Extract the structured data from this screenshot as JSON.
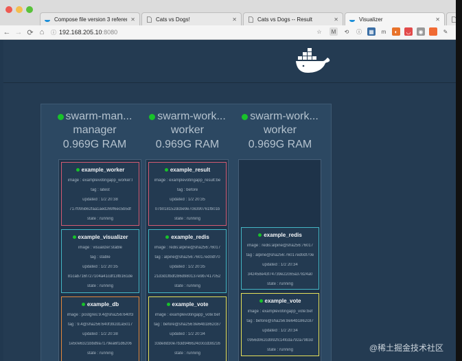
{
  "browser": {
    "tabs": [
      {
        "label": "Compose file version 3 referen",
        "icon": "docker-icon"
      },
      {
        "label": "Cats vs Dogs!",
        "icon": "page-icon"
      },
      {
        "label": "Cats vs Dogs -- Result",
        "icon": "page-icon"
      },
      {
        "label": "Visualizer",
        "icon": "docker-icon",
        "active": true
      }
    ],
    "url": {
      "host": "192.168.205.10",
      "port": ":8080"
    }
  },
  "swarm": {
    "nodes": [
      {
        "name": "swarm-man...",
        "role": "manager",
        "ram": "0.969G RAM",
        "containers": [
          {
            "name": "example_worker",
            "image": "image : examplevotingapp_worker:l",
            "tag": "tag : latest",
            "updated": "updated : 1/2 20:38",
            "id": "717f095b62faa1aed269f6ec5b5df",
            "state": "state : running",
            "color": "red"
          },
          {
            "name": "example_visualizer",
            "image": "image : visualizer:stable",
            "tag": "tag : stable",
            "updated": "updated : 1/2 20:35",
            "id": "81cab716f727104a41cdf13fb161de",
            "state": "state : running",
            "color": "teal"
          },
          {
            "name": "example_db",
            "image": "image : postgres:9.4@sha256:640f3",
            "tag": "tag : 9.4@sha256:640f392d1a5017",
            "updated": "updated : 1/2 20:38",
            "id": "1e50e6321bbd9a7179ea6f1d6206",
            "state": "state : running",
            "color": "orange"
          }
        ]
      },
      {
        "name": "swarm-work...",
        "role": "worker",
        "ram": "0.969G RAM",
        "containers": [
          {
            "name": "example_result",
            "image": "image : examplevotingapp_result:be",
            "tag": "tag : before",
            "updated": "updated : 1/2 20:35",
            "id": "07b018152dcbe9e7c6390761fb01b",
            "state": "state : running",
            "color": "red"
          },
          {
            "name": "example_redis",
            "image": "image : redis:alpine@sha256:76017",
            "tag": "tag : alpine@sha256:76017ed0df70",
            "updated": "updated : 1/2 20:35",
            "id": "21d3d1fbdf286d980137e9b7417052",
            "state": "state : running",
            "color": "teal"
          },
          {
            "name": "example_vote",
            "image": "image : examplevotingapp_vote:bef",
            "tag": "tag : before@sha256:8e64b1862c87",
            "updated": "updated : 1/2 20:34",
            "id": "33de8d30e7b3d946624c0ccd38216",
            "state": "state : running",
            "color": "yellow"
          }
        ]
      },
      {
        "name": "swarm-work...",
        "role": "worker",
        "ram": "0.969G RAM",
        "containers": [
          {
            "name": "example_redis",
            "image": "image : redis:alpine@sha256:76017",
            "tag": "tag : alpine@sha256:76017ed0df70e",
            "updated": "updated : 1/2 20:34",
            "id": "342458e43f74739e22c65a37824a0",
            "state": "state : running",
            "color": "teal"
          },
          {
            "name": "example_vote",
            "image": "image : examplevotingapp_vote:bef",
            "tag": "tag : before@sha256:8e64b1862c87",
            "updated": "updated : 1/2 20:34",
            "id": "0956d062cd992fc14fcda792a79b3d",
            "state": "state : running",
            "color": "yellow"
          }
        ]
      }
    ]
  },
  "watermark": "@稀土掘金技术社区",
  "colors": {
    "accent_red": "#d55b73",
    "accent_teal": "#45b7c6",
    "accent_orange": "#e58a3e",
    "accent_yellow": "#e8e25a",
    "status_green": "#18c22a"
  }
}
